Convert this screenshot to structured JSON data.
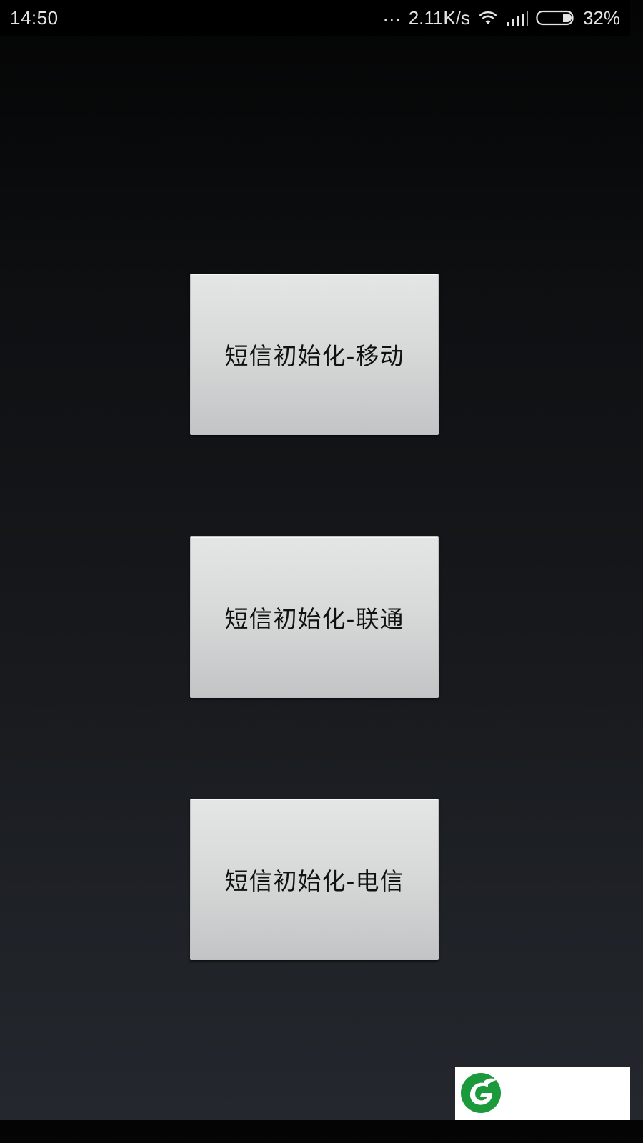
{
  "status_bar": {
    "time": "14:50",
    "dots": "...",
    "net_speed": "2.11K/s",
    "battery_percent": "32%",
    "battery_level": 0.32,
    "icons": [
      "wifi-icon",
      "signal-icon",
      "battery-icon"
    ]
  },
  "buttons": [
    {
      "label": "短信初始化-移动"
    },
    {
      "label": "短信初始化-联通"
    },
    {
      "label": "短信初始化-电信"
    }
  ],
  "colors": {
    "status_bar_bg": "#000000",
    "button_face": "#d8d9d9",
    "button_text": "#111111",
    "logo_green": "#1a9a3a"
  },
  "logo": {
    "icon": "leaf-logo-icon"
  }
}
